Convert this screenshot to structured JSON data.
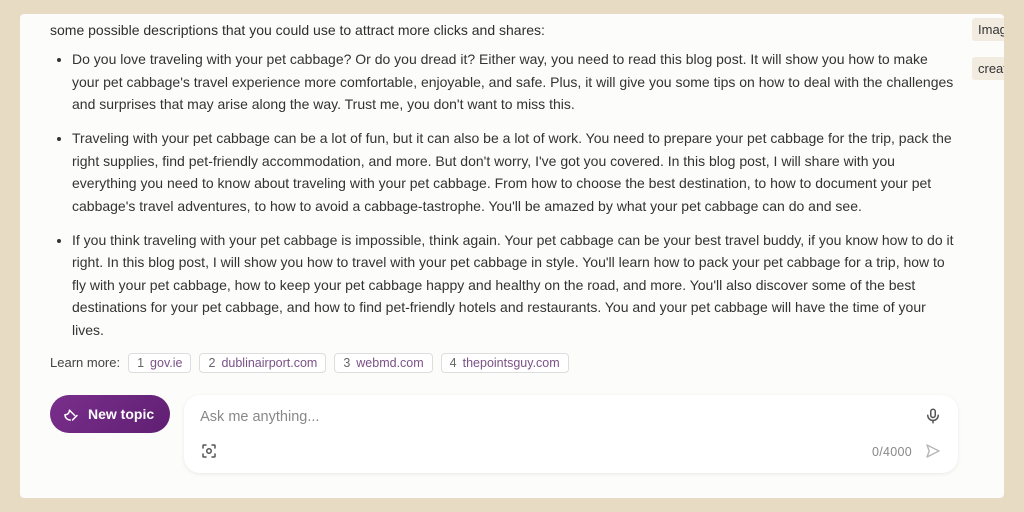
{
  "response": {
    "intro": "some possible descriptions that you could use to attract more clicks and shares:",
    "bullets": [
      "Do you love traveling with your pet cabbage? Or do you dread it? Either way, you need to read this blog post. It will show you how to make your pet cabbage's travel experience more comfortable, enjoyable, and safe. Plus, it will give you some tips on how to deal with the challenges and surprises that may arise along the way. Trust me, you don't want to miss this.",
      "Traveling with your pet cabbage can be a lot of fun, but it can also be a lot of work. You need to prepare your pet cabbage for the trip, pack the right supplies, find pet-friendly accommodation, and more. But don't worry, I've got you covered. In this blog post, I will share with you everything you need to know about traveling with your pet cabbage. From how to choose the best destination, to how to document your pet cabbage's travel adventures, to how to avoid a cabbage-tastrophe. You'll be amazed by what your pet cabbage can do and see.",
      "If you think traveling with your pet cabbage is impossible, think again. Your pet cabbage can be your best travel buddy, if you know how to do it right. In this blog post, I will show you how to travel with your pet cabbage in style. You'll learn how to pack your pet cabbage for a trip, how to fly with your pet cabbage, how to keep your pet cabbage happy and healthy on the road, and more. You'll also discover some of the best destinations for your pet cabbage, and how to find pet-friendly hotels and restaurants. You and your pet cabbage will have the time of your lives."
    ]
  },
  "learn_more": {
    "label": "Learn more:",
    "sources": [
      {
        "n": "1",
        "domain": "gov.ie"
      },
      {
        "n": "2",
        "domain": "dublinairport.com"
      },
      {
        "n": "3",
        "domain": "webmd.com"
      },
      {
        "n": "4",
        "domain": "thepointsguy.com"
      }
    ]
  },
  "compose": {
    "new_topic_label": "New topic",
    "placeholder": "Ask me anything...",
    "counter": "0/4000"
  },
  "sidebar": {
    "items": [
      {
        "label": "Image"
      },
      {
        "label": "create"
      }
    ]
  }
}
